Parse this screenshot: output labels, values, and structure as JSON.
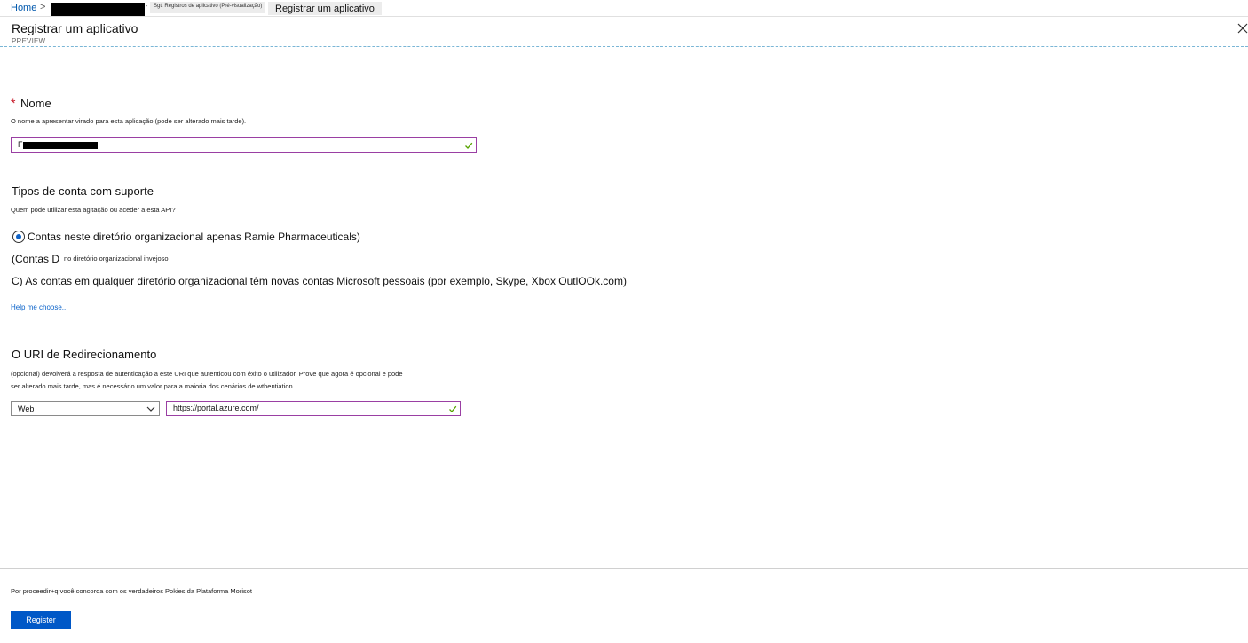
{
  "breadcrumb": {
    "home": "Home",
    "separator": ">",
    "dash": "-",
    "tab_small": "Sgt. Registros de aplicativo (Pré-visualização)",
    "tab_current": "Registrar um aplicativo"
  },
  "blade": {
    "title": "Registrar um aplicativo",
    "subtitle": "PREVIEW"
  },
  "name_section": {
    "required_mark": "*",
    "heading": "Nome",
    "description": "O nome a apresentar virado para esta aplicação (pode ser alterado mais tarde).",
    "value": "F"
  },
  "account_types": {
    "heading": "Tipos de conta com suporte",
    "question": "Quem pode utilizar esta agitação ou aceder a esta API?",
    "option_1": "Contas neste diretório organizacional apenas Ramie Pharmaceuticals)",
    "option_2_main": "(Contas D",
    "option_2_small": "no diretório organizacional invejoso",
    "option_3": "C) As contas em qualquer diretório organizacional têm novas contas Microsoft pessoais (por exemplo, Skype, Xbox OutlOOk.com)",
    "help_link": "Help me choose..."
  },
  "redirect": {
    "heading": "O URI de Redirecionamento",
    "desc_line1": "(opcional) devolverá a resposta de autenticação a este URI que autenticou com êxito o utilizador. Prove que agora é opcional e pode",
    "desc_line2": "ser alterado mais tarde, mas é necessário um valor para a maioria dos cenários de wthentiation.",
    "platform": "Web",
    "uri": "https://portal.azure.com/"
  },
  "footer": {
    "agreement": "Por proceedir+q você concorda com os verdadeiros Pokies da Plataforma Morisot",
    "register_label": "Register"
  },
  "colors": {
    "primary": "#0058c7",
    "link": "#0a62c9",
    "valid_border": "#9a3fa3",
    "valid_check": "#57a300",
    "required": "#c50f1f"
  }
}
